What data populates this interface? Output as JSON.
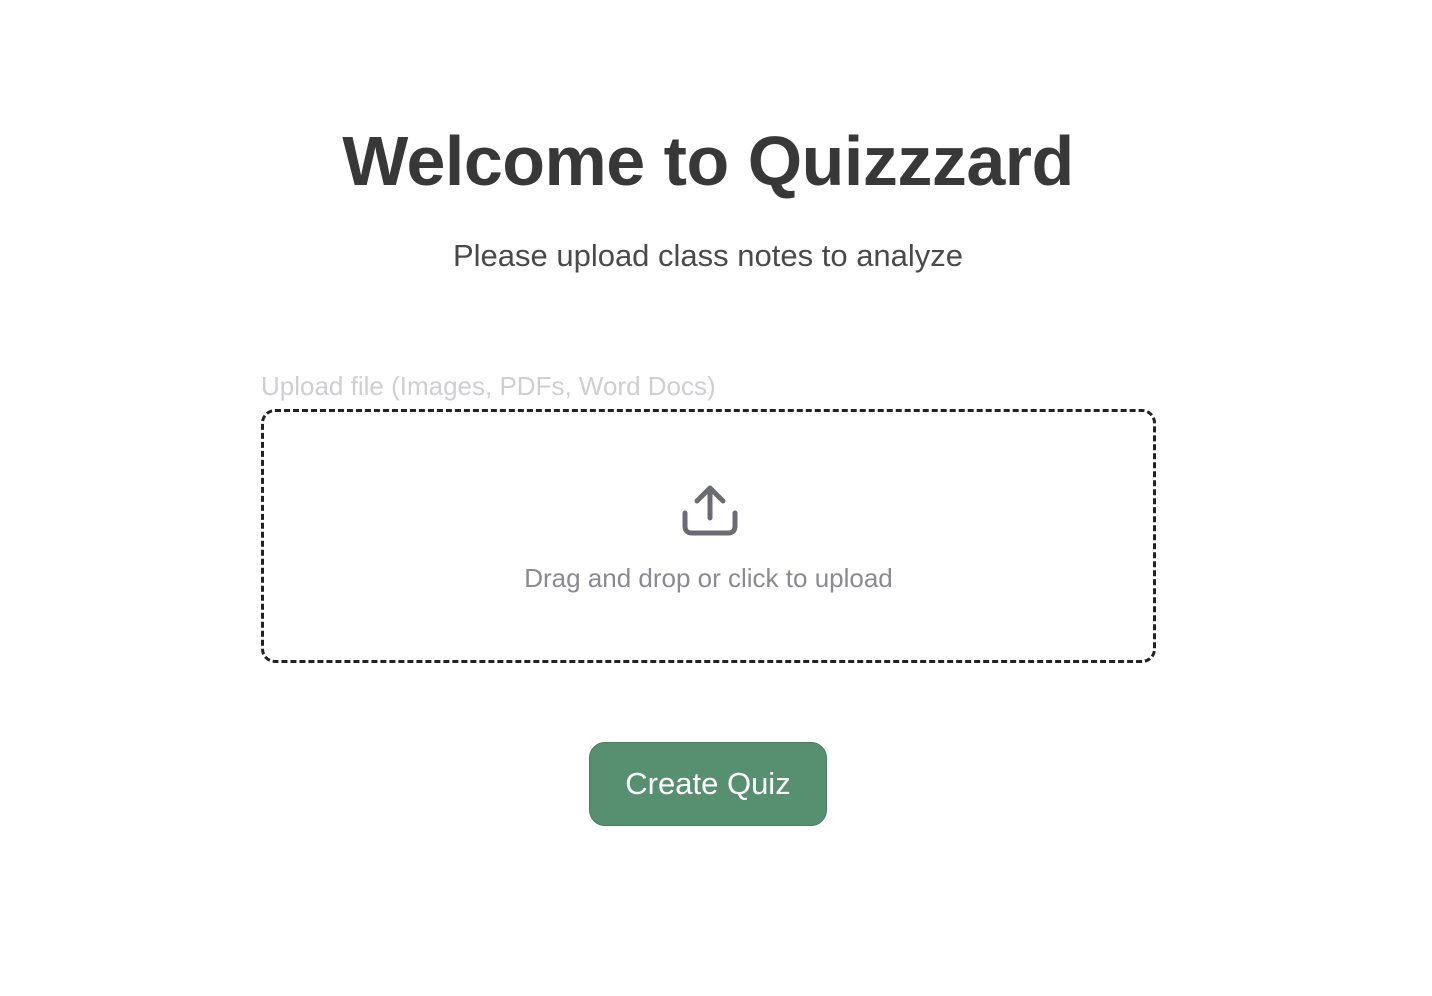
{
  "header": {
    "title": "Welcome to Quizzzard",
    "subtitle": "Please upload class notes to analyze"
  },
  "upload": {
    "label": "Upload file (Images, PDFs, Word Docs)",
    "dropzone_text": "Drag and drop or click to upload",
    "icon": "upload-icon"
  },
  "actions": {
    "create_label": "Create Quiz"
  },
  "colors": {
    "title": "#383838",
    "label": "#cfcfd3",
    "dropzone_border": "#222222",
    "dropzone_text": "#8a8a90",
    "icon": "#6b6b73",
    "button_bg": "#578f71",
    "button_text": "#ffffff"
  }
}
